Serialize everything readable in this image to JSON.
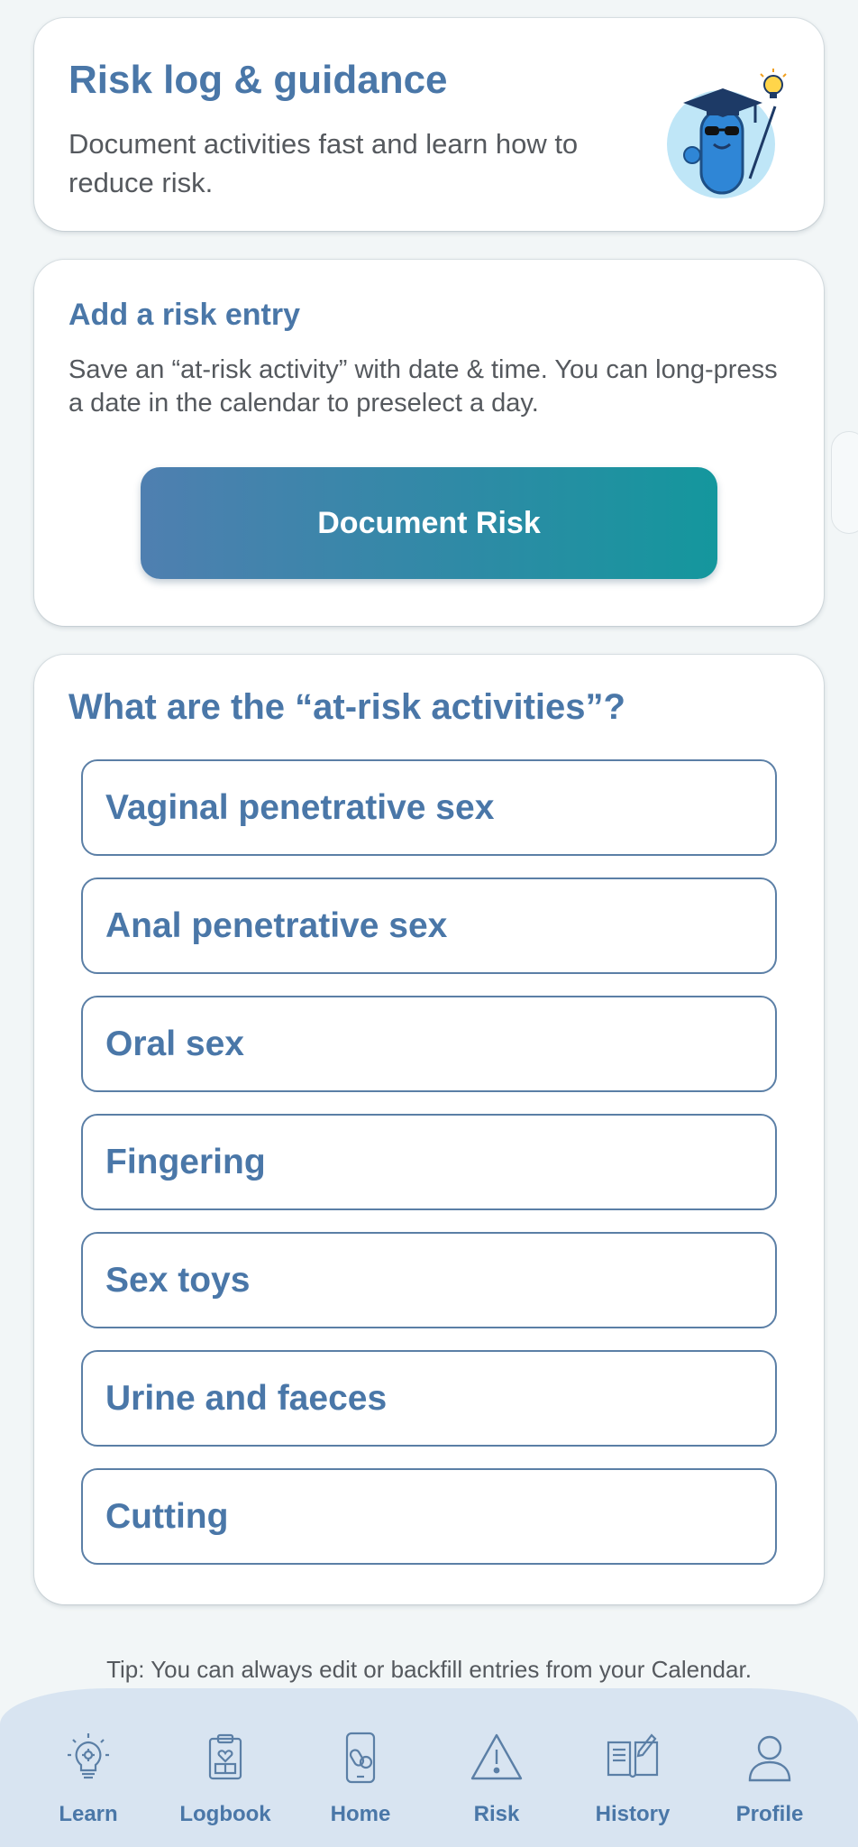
{
  "header": {
    "title": "Risk log & guidance",
    "subtitle": "Document activities fast and learn how to reduce risk."
  },
  "add_entry": {
    "title": "Add a risk entry",
    "description": "Save an “at-risk activity” with date & time. You can long-press a date in the calendar to preselect a day.",
    "button_label": "Document Risk"
  },
  "activities": {
    "title": "What are the “at-risk activities”?",
    "items": [
      "Vaginal penetrative sex",
      "Anal penetrative sex",
      "Oral sex",
      "Fingering",
      "Sex toys",
      "Urine and faeces",
      "Cutting"
    ]
  },
  "tip": "Tip: You can always edit or backfill entries from your Calendar.",
  "nav": {
    "items": [
      {
        "label": "Learn",
        "icon": "lightbulb-gear-icon"
      },
      {
        "label": "Logbook",
        "icon": "clipboard-heart-icon"
      },
      {
        "label": "Home",
        "icon": "phone-pills-icon"
      },
      {
        "label": "Risk",
        "icon": "warning-triangle-icon"
      },
      {
        "label": "History",
        "icon": "open-book-pen-icon"
      },
      {
        "label": "Profile",
        "icon": "person-icon"
      }
    ]
  },
  "colors": {
    "accent": "#4a77a8",
    "button_gradient_start": "#4f7fb0",
    "button_gradient_end": "#14979d",
    "nav_background": "#d8e4f1",
    "page_background": "#f2f6f7"
  }
}
